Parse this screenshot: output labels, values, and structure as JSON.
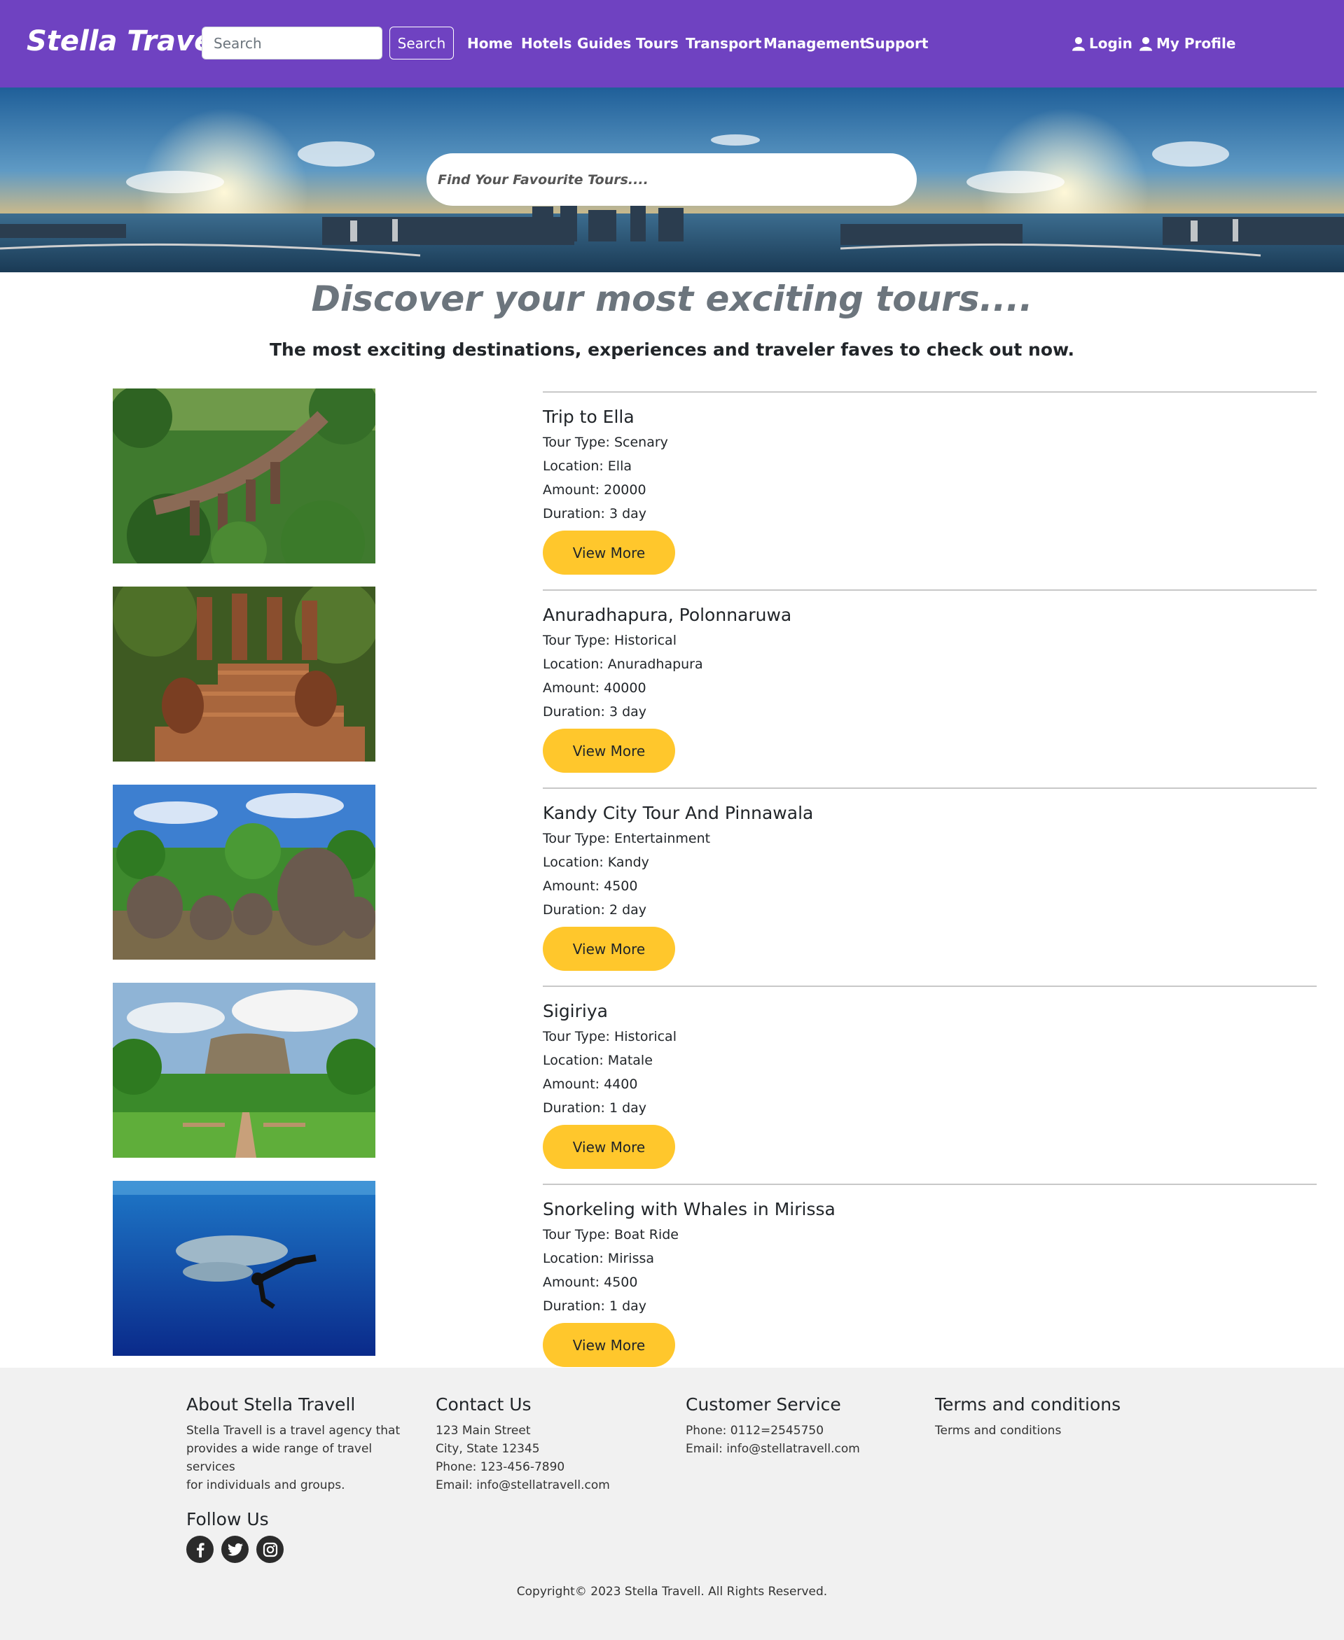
{
  "navbar": {
    "brand": "Stella Travel",
    "search_placeholder": "Search",
    "search_button": "Search",
    "links": [
      "Home",
      "Hotels",
      "Guides",
      "Tours",
      "Transport",
      "Management",
      "Support"
    ],
    "login": "Login",
    "profile": "My Profile"
  },
  "hero": {
    "search_placeholder": "Find Your Favourite Tours...."
  },
  "headline": {
    "title": "Discover your most exciting tours....",
    "subtitle": "The most exciting destinations, experiences and traveler faves to check out now."
  },
  "tours": [
    {
      "name": "Trip to Ella",
      "type": "Tour Type: Scenary",
      "location": "Location: Ella",
      "amount": "Amount: 20000",
      "duration": "Duration: 3 day",
      "button": "View More",
      "image": "ella-bridge"
    },
    {
      "name": "Anuradhapura, Polonnaruwa",
      "type": "Tour Type: Historical",
      "location": "Location: Anuradhapura",
      "amount": "Amount: 40000",
      "duration": "Duration: 3 day",
      "button": "View More",
      "image": "ancient-ruins"
    },
    {
      "name": "Kandy City Tour And Pinnawala",
      "type": "Tour Type: Entertainment",
      "location": "Location: Kandy",
      "amount": "Amount: 4500",
      "duration": "Duration: 2 day",
      "button": "View More",
      "image": "elephants"
    },
    {
      "name": "Sigiriya",
      "type": "Tour Type: Historical",
      "location": "Location: Matale",
      "amount": "Amount: 4400",
      "duration": "Duration: 1 day",
      "button": "View More",
      "image": "sigiriya-rock"
    },
    {
      "name": "Snorkeling with Whales in Mirissa",
      "type": "Tour Type: Boat Ride",
      "location": "Location: Mirissa",
      "amount": "Amount: 4500",
      "duration": "Duration: 1 day",
      "button": "View More",
      "image": "whale-snorkel"
    }
  ],
  "footer": {
    "about": {
      "title": "About Stella Travell",
      "lines": [
        "Stella Travell is a travel agency that",
        "provides a wide range of travel services",
        "for individuals and groups."
      ]
    },
    "contact": {
      "title": "Contact Us",
      "lines": [
        "123 Main Street",
        "City, State 12345",
        "Phone: 123-456-7890",
        "Email: info@stellatravell.com"
      ]
    },
    "service": {
      "title": "Customer Service",
      "lines": [
        "Phone: 0112=2545750",
        "Email: info@stellatravell.com"
      ]
    },
    "terms": {
      "title": "Terms and conditions",
      "lines": [
        "Terms and conditions"
      ]
    },
    "follow": {
      "title": "Follow Us",
      "icons": [
        "facebook-icon",
        "twitter-icon",
        "instagram-icon"
      ]
    },
    "copyright": "Copyright© 2023 Stella Travell. All Rights Reserved."
  },
  "colors": {
    "navbar": "#6f42c1",
    "button": "#ffc72c",
    "footer": "#f1f1f1",
    "heading_gray": "#6c757d"
  }
}
